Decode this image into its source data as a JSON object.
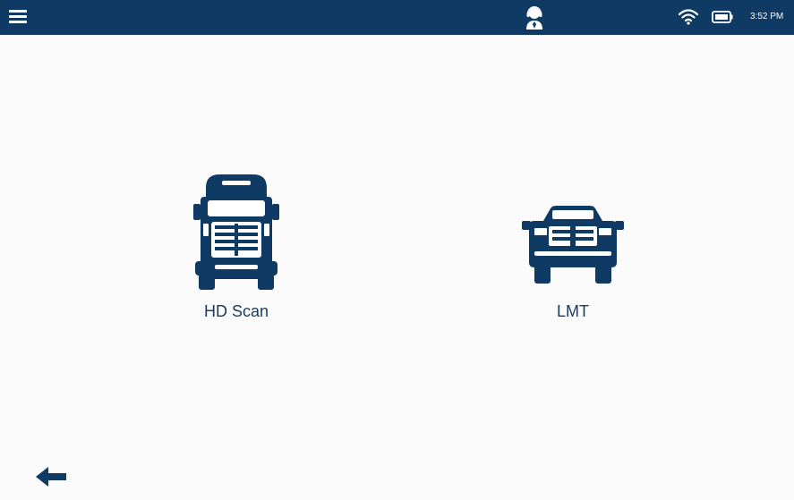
{
  "status_bar": {
    "menu_icon": "hamburger-menu-icon",
    "support_icon": "headset-agent-icon",
    "wifi_icon": "wifi-icon",
    "battery_icon": "battery-icon",
    "time": "3:52 PM"
  },
  "options": [
    {
      "label": "HD Scan",
      "icon": "semi-truck-icon"
    },
    {
      "label": "LMT",
      "icon": "pickup-truck-icon"
    }
  ],
  "nav": {
    "back_icon": "back-arrow-icon"
  },
  "colors": {
    "topbar": "#0e3a63",
    "accent": "#1a3b5e",
    "background": "#fbfbfb"
  }
}
